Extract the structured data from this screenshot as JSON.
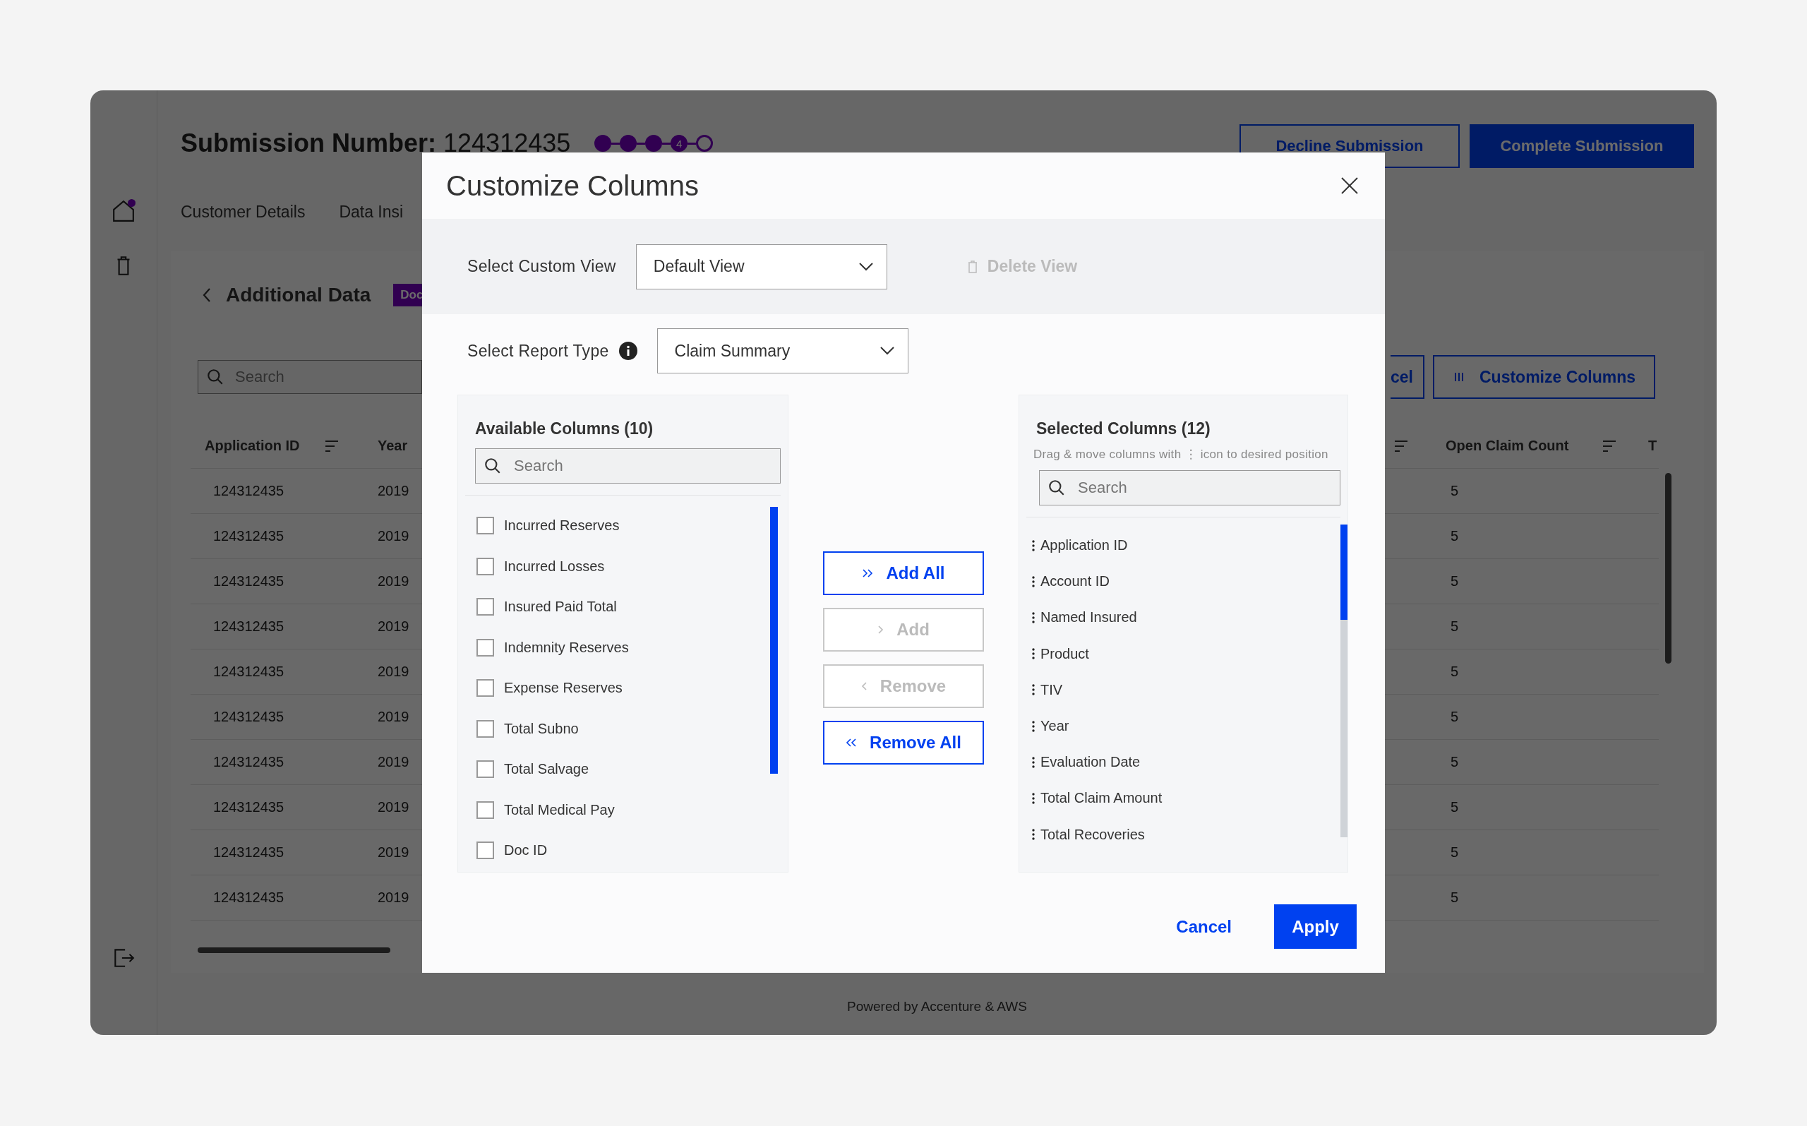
{
  "sidebar": {
    "items": [
      {
        "kind": "home",
        "dot": true
      },
      {
        "kind": "trash",
        "dot": false
      }
    ],
    "bottom": [
      {
        "kind": "logout",
        "dot": false
      }
    ]
  },
  "header": {
    "title_label": "Submission Number:",
    "title_value": "124312435",
    "stepper": [
      {
        "kind": "done"
      },
      {
        "kind": "done"
      },
      {
        "kind": "done"
      },
      {
        "kind": "current",
        "label": "4"
      },
      {
        "kind": "todo"
      }
    ],
    "actions": [
      {
        "label": "Decline Submission",
        "kind": "outline"
      },
      {
        "label": "Complete Submission",
        "kind": "primary"
      }
    ]
  },
  "tabs": [
    {
      "label": "Customer Details"
    },
    {
      "label": "Data Insi"
    }
  ],
  "panel": {
    "title": "Additional Data",
    "badge": "Doc",
    "search": {
      "placeholder": "Search"
    },
    "buttons": [
      {
        "label": "cel",
        "kind": "cut"
      },
      {
        "label": "Customize Columns",
        "kind": "columns"
      }
    ]
  },
  "table": {
    "columns": [
      {
        "label": "Application ID",
        "sort": true
      },
      {
        "label": "Year",
        "sort": false
      },
      {
        "sort": true
      },
      {
        "label": "Open Claim Count",
        "sort": true
      },
      {
        "label": "T",
        "sort": false
      }
    ],
    "rows": [
      {
        "application_id": "124312435",
        "year": "2019",
        "open_claim_count": "5"
      },
      {
        "application_id": "124312435",
        "year": "2019",
        "open_claim_count": "5"
      },
      {
        "application_id": "124312435",
        "year": "2019",
        "open_claim_count": "5"
      },
      {
        "application_id": "124312435",
        "year": "2019",
        "open_claim_count": "5"
      },
      {
        "application_id": "124312435",
        "year": "2019",
        "open_claim_count": "5"
      },
      {
        "application_id": "124312435",
        "year": "2019",
        "open_claim_count": "5"
      },
      {
        "application_id": "124312435",
        "year": "2019",
        "open_claim_count": "5"
      },
      {
        "application_id": "124312435",
        "year": "2019",
        "open_claim_count": "5"
      },
      {
        "application_id": "124312435",
        "year": "2019",
        "open_claim_count": "5"
      },
      {
        "application_id": "124312435",
        "year": "2019",
        "open_claim_count": "5"
      }
    ]
  },
  "footer": "Powered by Accenture & AWS",
  "modal": {
    "title": "Customize Columns",
    "custom_view": {
      "label": "Select Custom View",
      "value": "Default View"
    },
    "delete_view": {
      "label": "Delete View",
      "disabled": true
    },
    "report_type": {
      "label": "Select Report Type",
      "value": "Claim Summary"
    },
    "available": {
      "title": "Available Columns (10)",
      "search": {
        "placeholder": "Search"
      },
      "items": [
        {
          "label": "Incurred Reserves",
          "checked": false
        },
        {
          "label": "Incurred Losses",
          "checked": false
        },
        {
          "label": "Insured Paid Total",
          "checked": false
        },
        {
          "label": "Indemnity Reserves",
          "checked": false
        },
        {
          "label": "Expense Reserves",
          "checked": false
        },
        {
          "label": "Total Subno",
          "checked": false
        },
        {
          "label": "Total Salvage",
          "checked": false
        },
        {
          "label": "Total Medical Pay",
          "checked": false
        },
        {
          "label": "Doc ID",
          "checked": false
        }
      ]
    },
    "transfer_buttons": [
      {
        "label": "Add All",
        "kind": "add_all",
        "disabled": false
      },
      {
        "label": "Add",
        "kind": "add",
        "disabled": true
      },
      {
        "label": "Remove",
        "kind": "remove",
        "disabled": true
      },
      {
        "label": "Remove All",
        "kind": "remove_all",
        "disabled": false
      }
    ],
    "selected": {
      "title": "Selected Columns (12)",
      "hint": "Drag & move columns with ⋮ icon to desired position",
      "search": {
        "placeholder": "Search"
      },
      "items": [
        {
          "label": "Application ID"
        },
        {
          "label": "Account ID"
        },
        {
          "label": "Named Insured"
        },
        {
          "label": "Product"
        },
        {
          "label": "TIV"
        },
        {
          "label": "Year"
        },
        {
          "label": "Evaluation Date"
        },
        {
          "label": "Total Claim Amount"
        },
        {
          "label": "Total Recoveries"
        }
      ]
    },
    "footer_buttons": [
      {
        "label": "Cancel",
        "kind": "text"
      },
      {
        "label": "Apply",
        "kind": "primary"
      }
    ]
  }
}
